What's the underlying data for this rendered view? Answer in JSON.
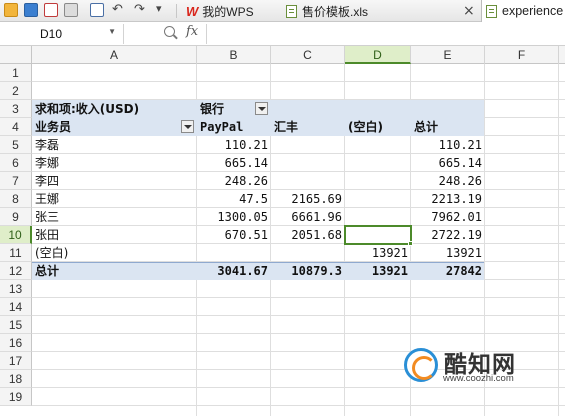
{
  "toolbar": {
    "undo_glyph": "↶",
    "redo_glyph": "↷",
    "more_glyph": "▾",
    "icons": [
      "folder-open-icon",
      "save-icon",
      "export-pdf-icon",
      "print-icon",
      "print-preview-icon",
      "undo-icon",
      "redo-icon",
      "customize-toolbar-icon"
    ]
  },
  "tabs": [
    {
      "label": "我的WPS",
      "logo": "W"
    },
    {
      "label": "售价模板.xls",
      "close": "×"
    },
    {
      "label": "experience"
    }
  ],
  "formula_bar": {
    "cell_ref": "D10",
    "fx_label": "fx",
    "content": ""
  },
  "columns": [
    "A",
    "B",
    "C",
    "D",
    "E",
    "F"
  ],
  "selected_column": "D",
  "rows": [
    "1",
    "2",
    "3",
    "4",
    "5",
    "6",
    "7",
    "8",
    "9",
    "10",
    "11",
    "12",
    "13",
    "14",
    "15",
    "16",
    "17",
    "18",
    "19"
  ],
  "selected_row": "10",
  "pivot": {
    "title": "求和项:收入(USD)",
    "column_field": "银行",
    "row_field": "业务员",
    "column_headers": [
      "PayPal",
      "汇丰",
      "(空白)",
      "总计"
    ],
    "rows": [
      {
        "name": "李磊",
        "values": [
          "110.21",
          "",
          "",
          "110.21"
        ]
      },
      {
        "name": "李娜",
        "values": [
          "665.14",
          "",
          "",
          "665.14"
        ]
      },
      {
        "name": "李四",
        "values": [
          "248.26",
          "",
          "",
          "248.26"
        ]
      },
      {
        "name": "王娜",
        "values": [
          "47.5",
          "2165.69",
          "",
          "2213.19"
        ]
      },
      {
        "name": "张三",
        "values": [
          "1300.05",
          "6661.96",
          "",
          "7962.01"
        ]
      },
      {
        "name": "张田",
        "values": [
          "670.51",
          "2051.68",
          "",
          "2722.19"
        ]
      },
      {
        "name": "(空白)",
        "values": [
          "",
          "",
          "13921",
          "13921"
        ]
      }
    ],
    "total_label": "总计",
    "totals": [
      "3041.67",
      "10879.3",
      "13921",
      "27842"
    ]
  },
  "colors": {
    "pivot_band": "#dbe5f2",
    "selection": "#4c8a2a",
    "header_highlight": "#dfeec9"
  },
  "watermark": {
    "main": "酷知网",
    "sub": "www.coozhi.com"
  }
}
